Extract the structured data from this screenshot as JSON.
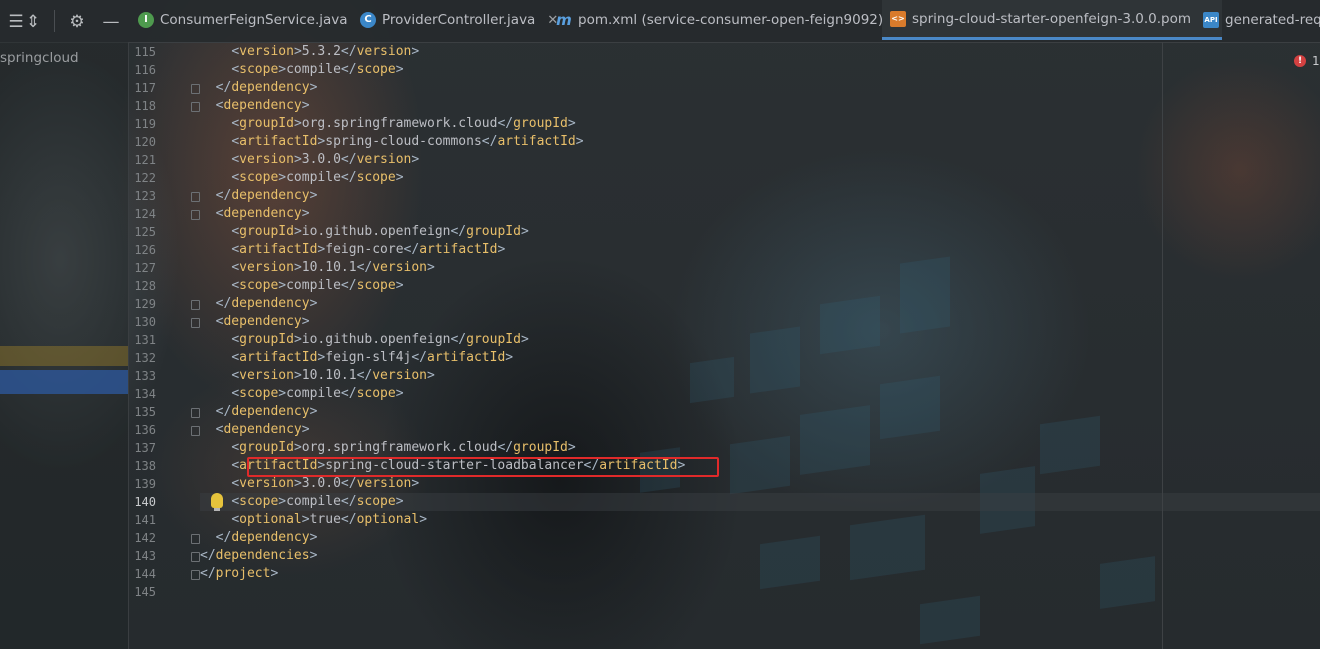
{
  "toolbar": {
    "icons": [
      "collapse-all-icon",
      "expand-all-icon",
      "gear-icon",
      "minimize-icon"
    ]
  },
  "tabs": [
    {
      "label": "ConsumerFeignService.java",
      "icon": "interface-icon",
      "color": "#4e9a4e",
      "letter": "I"
    },
    {
      "label": "ProviderController.java",
      "icon": "class-icon",
      "color": "#3b87c8",
      "letter": "C"
    },
    {
      "label": "pom.xml (service-consumer-open-feign9092)",
      "icon": "maven-icon",
      "color": "#3b87c8",
      "letter": "m"
    },
    {
      "label": "spring-cloud-starter-openfeign-3.0.0.pom",
      "icon": "xml-file-icon",
      "color": "#d97b2c",
      "letter": "<>",
      "active": true
    },
    {
      "label": "generated-requ",
      "icon": "api-file-icon",
      "color": "#3b87c8",
      "letter": "API"
    }
  ],
  "sidebar": {
    "project_label": "springcloud"
  },
  "inspection": {
    "error_count": "1"
  },
  "editor": {
    "current_line": 140,
    "lines": [
      {
        "n": "115",
        "code": "    <version>5.3.2</version>"
      },
      {
        "n": "116",
        "code": "    <scope>compile</scope>"
      },
      {
        "n": "117",
        "code": "  </dependency>"
      },
      {
        "n": "118",
        "code": "  <dependency>"
      },
      {
        "n": "119",
        "code": "    <groupId>org.springframework.cloud</groupId>"
      },
      {
        "n": "120",
        "code": "    <artifactId>spring-cloud-commons</artifactId>"
      },
      {
        "n": "121",
        "code": "    <version>3.0.0</version>"
      },
      {
        "n": "122",
        "code": "    <scope>compile</scope>"
      },
      {
        "n": "123",
        "code": "  </dependency>"
      },
      {
        "n": "124",
        "code": "  <dependency>"
      },
      {
        "n": "125",
        "code": "    <groupId>io.github.openfeign</groupId>"
      },
      {
        "n": "126",
        "code": "    <artifactId>feign-core</artifactId>"
      },
      {
        "n": "127",
        "code": "    <version>10.10.1</version>"
      },
      {
        "n": "128",
        "code": "    <scope>compile</scope>"
      },
      {
        "n": "129",
        "code": "  </dependency>"
      },
      {
        "n": "130",
        "code": "  <dependency>"
      },
      {
        "n": "131",
        "code": "    <groupId>io.github.openfeign</groupId>"
      },
      {
        "n": "132",
        "code": "    <artifactId>feign-slf4j</artifactId>"
      },
      {
        "n": "133",
        "code": "    <version>10.10.1</version>"
      },
      {
        "n": "134",
        "code": "    <scope>compile</scope>"
      },
      {
        "n": "135",
        "code": "  </dependency>"
      },
      {
        "n": "136",
        "code": "  <dependency>"
      },
      {
        "n": "137",
        "code": "    <groupId>org.springframework.cloud</groupId>"
      },
      {
        "n": "138",
        "code": "    <artifactId>spring-cloud-starter-loadbalancer</artifactId>"
      },
      {
        "n": "139",
        "code": "    <version>3.0.0</version>"
      },
      {
        "n": "140",
        "code": "    <scope>compile</scope>"
      },
      {
        "n": "141",
        "code": "    <optional>true</optional>"
      },
      {
        "n": "142",
        "code": "  </dependency>"
      },
      {
        "n": "143",
        "code": "</dependencies>"
      },
      {
        "n": "144",
        "code": "</project>"
      },
      {
        "n": "145",
        "code": ""
      }
    ],
    "highlighted_line": "138",
    "highlight_color": "#e02a2a"
  }
}
